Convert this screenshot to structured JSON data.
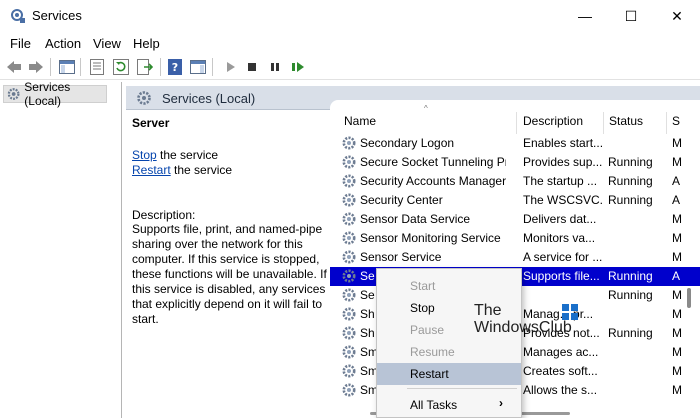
{
  "window": {
    "title": "Services",
    "minimize": "—",
    "maximize": "☐",
    "close": "✕"
  },
  "menu": [
    "File",
    "Action",
    "View",
    "Help"
  ],
  "tree": {
    "root_label": "Services (Local)"
  },
  "pane": {
    "header": "Services (Local)",
    "selected_service": "Server",
    "stop_link": "Stop",
    "stop_suffix": " the service",
    "restart_link": "Restart",
    "restart_suffix": " the service",
    "description_label": "Description:",
    "description": "Supports file, print, and named-pipe sharing over the network for this computer. If this service is stopped, these functions will be unavailable. If this service is disabled, any services that explicitly depend on it will fail to start."
  },
  "list": {
    "columns": [
      "Name",
      "Description",
      "Status",
      "S"
    ],
    "rows": [
      {
        "name": "Secondary Logon",
        "description": "Enables start...",
        "status": "",
        "startup": "M"
      },
      {
        "name": "Secure Socket Tunneling Pro...",
        "description": "Provides sup...",
        "status": "Running",
        "startup": "M"
      },
      {
        "name": "Security Accounts Manager",
        "description": "The startup ...",
        "status": "Running",
        "startup": "A"
      },
      {
        "name": "Security Center",
        "description": "The WSCSVC...",
        "status": "Running",
        "startup": "A"
      },
      {
        "name": "Sensor Data Service",
        "description": "Delivers dat...",
        "status": "",
        "startup": "M"
      },
      {
        "name": "Sensor Monitoring Service",
        "description": "Monitors va...",
        "status": "",
        "startup": "M"
      },
      {
        "name": "Sensor Service",
        "description": "A service for ...",
        "status": "",
        "startup": "M"
      },
      {
        "name": "Se",
        "description": "Supports file...",
        "status": "Running",
        "startup": "A",
        "selected": true
      },
      {
        "name": "Se",
        "description": "",
        "status": "Running",
        "startup": "M"
      },
      {
        "name": "Sh",
        "description": "Manag... pr...",
        "status": "",
        "startup": "M"
      },
      {
        "name": "Sh",
        "description": "Provides not...",
        "status": "Running",
        "startup": "M"
      },
      {
        "name": "Sm",
        "description": "Manages ac...",
        "status": "",
        "startup": "M"
      },
      {
        "name": "Sm",
        "description": "Creates soft...",
        "status": "",
        "startup": "M"
      },
      {
        "name": "Sm",
        "description": "Allows the s...",
        "status": "",
        "startup": "M"
      }
    ]
  },
  "context_menu": {
    "items": [
      {
        "label": "Start",
        "disabled": true
      },
      {
        "label": "Stop",
        "disabled": false
      },
      {
        "label": "Pause",
        "disabled": true
      },
      {
        "label": "Resume",
        "disabled": true
      },
      {
        "label": "Restart",
        "disabled": false,
        "highlighted": true
      },
      {
        "label": "All Tasks",
        "disabled": false,
        "submenu": true
      }
    ],
    "submenu_arrow": "›"
  },
  "watermark": {
    "line1": "The",
    "line2": "WindowsClub"
  },
  "colors": {
    "selection": "#0000cc",
    "link": "#0645ad",
    "header_band": "#d9dfe8",
    "menu_highlight": "#b8c4d6"
  }
}
